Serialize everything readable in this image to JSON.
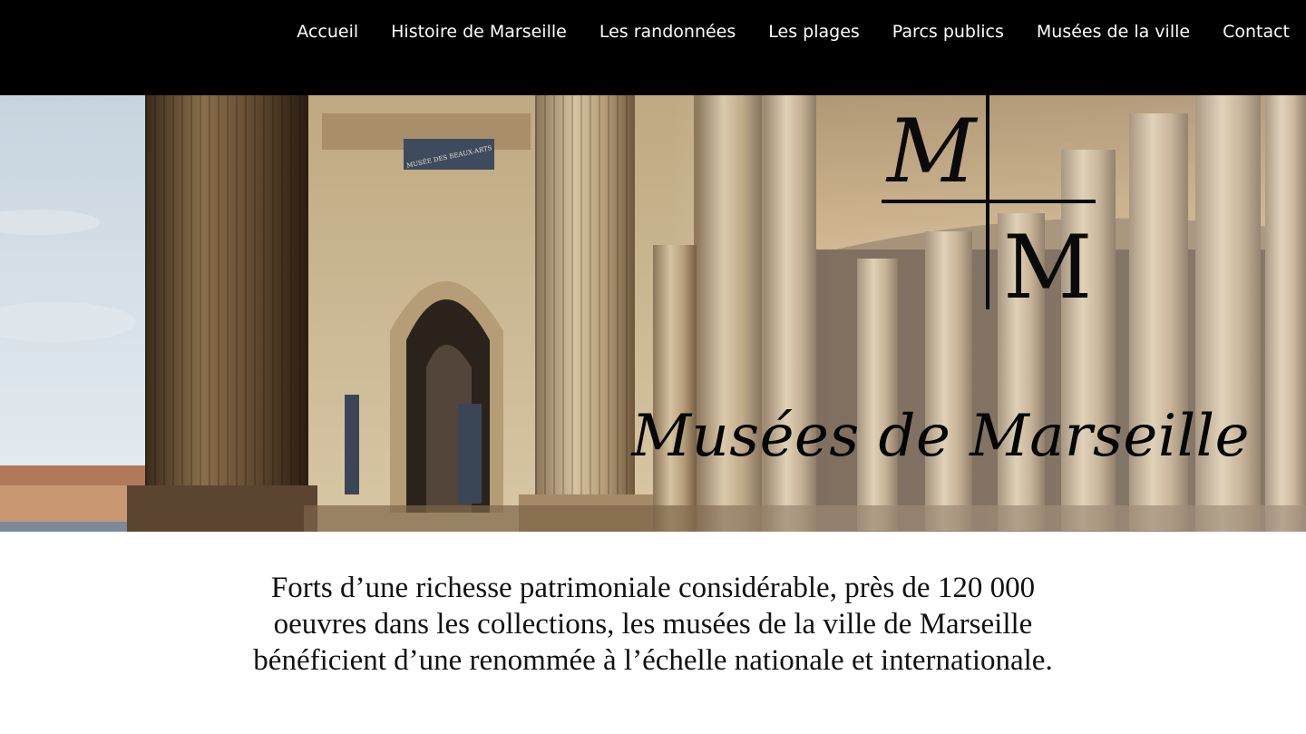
{
  "nav": {
    "items": [
      {
        "label": "Accueil"
      },
      {
        "label": "Histoire de Marseille"
      },
      {
        "label": "Les randonnées"
      },
      {
        "label": "Les plages"
      },
      {
        "label": "Parcs publics"
      },
      {
        "label": "Musées de la ville"
      },
      {
        "label": "Contact"
      }
    ]
  },
  "hero": {
    "monogram": {
      "top_letter": "M",
      "bottom_letter": "M"
    },
    "title": "Musées de Marseille",
    "building_inscription": "MUSÉE DES BEAUX-ARTS"
  },
  "intro": {
    "text": "Forts d’une richesse patrimoniale considérable, près de 120 000 oeuvres dans les collections, les musées de la ville de Marseille bénéficient d’une renommée à l’échelle nationale et internationale."
  },
  "colors": {
    "nav_background": "#000000",
    "nav_text": "#ffffff",
    "body_text": "#111111",
    "stone": "#c9b594"
  }
}
